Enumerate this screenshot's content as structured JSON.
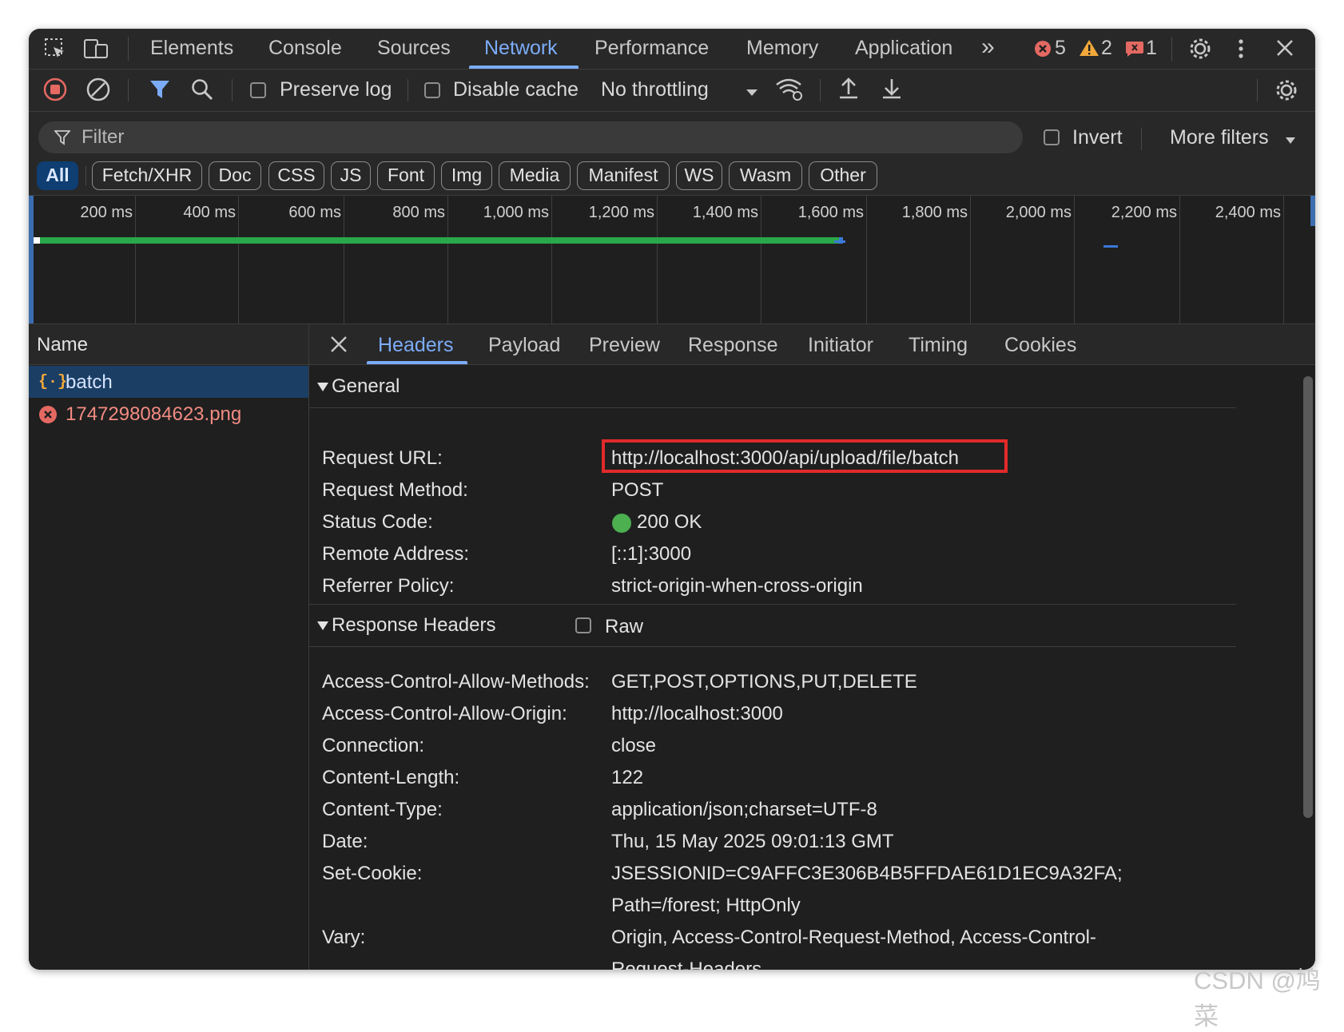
{
  "top_tabs": {
    "items": [
      "Elements",
      "Console",
      "Sources",
      "Network",
      "Performance",
      "Memory",
      "Application"
    ],
    "active": "Network",
    "more": "»",
    "errors_count": "5",
    "warnings_count": "2",
    "issues_count": "1"
  },
  "toolbar": {
    "preserve_log": "Preserve log",
    "disable_cache": "Disable cache",
    "throttling": "No throttling"
  },
  "filter": {
    "placeholder": "Filter",
    "invert": "Invert",
    "more_filters": "More filters"
  },
  "type_filters": [
    "All",
    "Fetch/XHR",
    "Doc",
    "CSS",
    "JS",
    "Font",
    "Img",
    "Media",
    "Manifest",
    "WS",
    "Wasm",
    "Other"
  ],
  "timeline": {
    "ticks": [
      "200 ms",
      "400 ms",
      "600 ms",
      "800 ms",
      "1,000 ms",
      "1,200 ms",
      "1,400 ms",
      "1,600 ms",
      "1,800 ms",
      "2,000 ms",
      "2,200 ms",
      "2,400 ms"
    ]
  },
  "requests": {
    "column": "Name",
    "items": [
      {
        "name": "batch",
        "selected": true
      },
      {
        "name": "1747298084623.png",
        "error": true
      }
    ]
  },
  "detail_tabs": {
    "items": [
      "Headers",
      "Payload",
      "Preview",
      "Response",
      "Initiator",
      "Timing",
      "Cookies"
    ],
    "active": "Headers"
  },
  "general": {
    "title": "General",
    "rows": [
      {
        "key": "Request URL:",
        "value": "http://localhost:3000/api/upload/file/batch"
      },
      {
        "key": "Request Method:",
        "value": "POST"
      },
      {
        "key": "Status Code:",
        "value": "200 OK"
      },
      {
        "key": "Remote Address:",
        "value": "[::1]:3000"
      },
      {
        "key": "Referrer Policy:",
        "value": "strict-origin-when-cross-origin"
      }
    ]
  },
  "response_headers": {
    "title": "Response Headers",
    "raw_label": "Raw",
    "rows": [
      {
        "key": "Access-Control-Allow-Methods:",
        "value": "GET,POST,OPTIONS,PUT,DELETE"
      },
      {
        "key": "Access-Control-Allow-Origin:",
        "value": "http://localhost:3000"
      },
      {
        "key": "Connection:",
        "value": "close"
      },
      {
        "key": "Content-Length:",
        "value": "122"
      },
      {
        "key": "Content-Type:",
        "value": "application/json;charset=UTF-8"
      },
      {
        "key": "Date:",
        "value": "Thu, 15 May 2025 09:01:13 GMT"
      },
      {
        "key": "Set-Cookie:",
        "value": "JSESSIONID=C9AFFC3E306B4B5FFDAE61D1EC9A32FA;",
        "value2": "Path=/forest; HttpOnly"
      },
      {
        "key": "Vary:",
        "value": "Origin, Access-Control-Request-Method, Access-Control-",
        "value2": "Request-Headers"
      }
    ]
  },
  "watermark": "CSDN @鸠菜",
  "colors": {
    "accent": "#7cacf8",
    "status_ok": "#4caf50",
    "error": "#e46962",
    "warning": "#f2a83b",
    "highlight_box": "#e12a2a"
  }
}
